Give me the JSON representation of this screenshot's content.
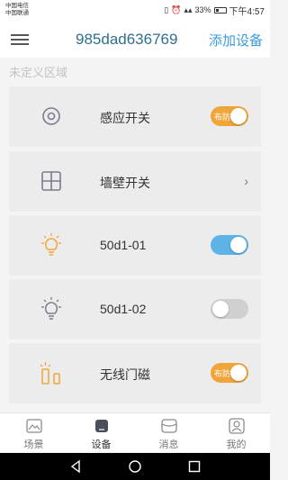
{
  "status_bar": {
    "carrier_1": "中国电信",
    "carrier_2": "中国联通",
    "icons": "᠎◫ ⚙ ⌚ 4G ᯤ 3G ◢ 33%",
    "battery_text": "33%",
    "time": "下午4:57"
  },
  "header": {
    "title": "985dad636769",
    "add_device": "添加设备"
  },
  "section": {
    "label": "未定义区域"
  },
  "devices": [
    {
      "label": "感应开关",
      "icon": "radio-target-icon",
      "control": "toggle",
      "state": "on",
      "toggle_text": "布防",
      "color": "#f0a53a"
    },
    {
      "label": "墙壁开关",
      "icon": "grid-square-icon",
      "control": "chevron",
      "chevron": "›"
    },
    {
      "label": "50d1-01",
      "icon": "lightbulb-on-icon",
      "control": "toggle",
      "state": "on",
      "toggle_text": "",
      "color": "#5db3e6"
    },
    {
      "label": "50d1-02",
      "icon": "lightbulb-off-icon",
      "control": "toggle",
      "state": "off",
      "toggle_text": "",
      "color": "#d0d0d0"
    },
    {
      "label": "无线门磁",
      "icon": "door-sensor-icon",
      "control": "toggle",
      "state": "on",
      "toggle_text": "布防",
      "color": "#f0a53a"
    }
  ],
  "tabs": [
    {
      "label": "场景",
      "icon": "scene-icon",
      "active": false
    },
    {
      "label": "设备",
      "icon": "device-icon",
      "active": true
    },
    {
      "label": "消息",
      "icon": "message-icon",
      "active": false
    },
    {
      "label": "我的",
      "icon": "profile-icon",
      "active": false
    }
  ],
  "colors": {
    "accent_orange": "#f0a53a",
    "accent_blue": "#5db3e6",
    "title_color": "#2e6f8c",
    "link_color": "#3b9ad8"
  }
}
